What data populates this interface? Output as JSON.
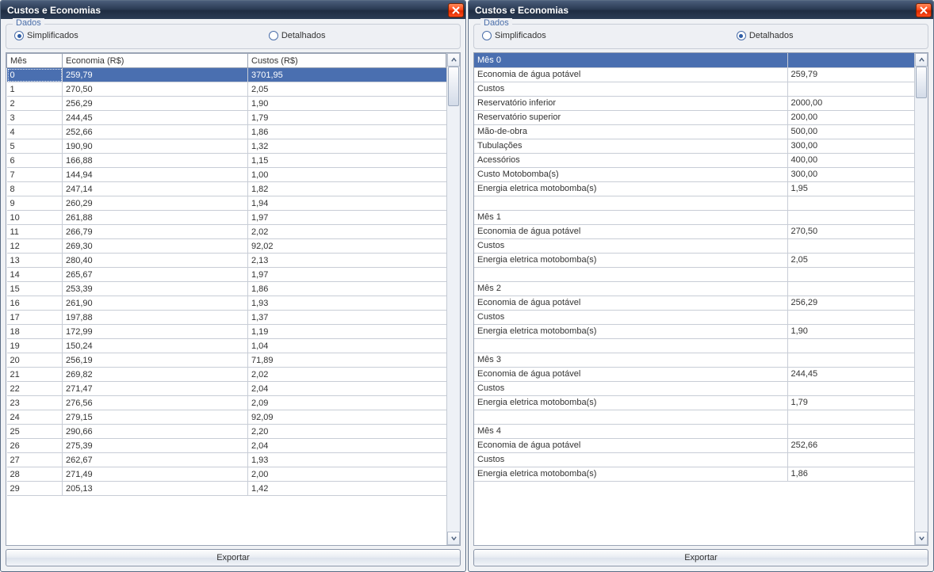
{
  "title": "Custos e Economias",
  "group_label": "Dados",
  "radio_simplificados": "Simplificados",
  "radio_detalhados": "Detalhados",
  "export_label": "Exportar",
  "simp_headers": {
    "mes": "Mês",
    "economia": "Economia (R$)",
    "custos": "Custos (R$)"
  },
  "simp_rows": [
    {
      "mes": "0",
      "economia": "259,79",
      "custos": "3701,95"
    },
    {
      "mes": "1",
      "economia": "270,50",
      "custos": "2,05"
    },
    {
      "mes": "2",
      "economia": "256,29",
      "custos": "1,90"
    },
    {
      "mes": "3",
      "economia": "244,45",
      "custos": "1,79"
    },
    {
      "mes": "4",
      "economia": "252,66",
      "custos": "1,86"
    },
    {
      "mes": "5",
      "economia": "190,90",
      "custos": "1,32"
    },
    {
      "mes": "6",
      "economia": "166,88",
      "custos": "1,15"
    },
    {
      "mes": "7",
      "economia": "144,94",
      "custos": "1,00"
    },
    {
      "mes": "8",
      "economia": "247,14",
      "custos": "1,82"
    },
    {
      "mes": "9",
      "economia": "260,29",
      "custos": "1,94"
    },
    {
      "mes": "10",
      "economia": "261,88",
      "custos": "1,97"
    },
    {
      "mes": "11",
      "economia": "266,79",
      "custos": "2,02"
    },
    {
      "mes": "12",
      "economia": "269,30",
      "custos": "92,02"
    },
    {
      "mes": "13",
      "economia": "280,40",
      "custos": "2,13"
    },
    {
      "mes": "14",
      "economia": "265,67",
      "custos": "1,97"
    },
    {
      "mes": "15",
      "economia": "253,39",
      "custos": "1,86"
    },
    {
      "mes": "16",
      "economia": "261,90",
      "custos": "1,93"
    },
    {
      "mes": "17",
      "economia": "197,88",
      "custos": "1,37"
    },
    {
      "mes": "18",
      "economia": "172,99",
      "custos": "1,19"
    },
    {
      "mes": "19",
      "economia": "150,24",
      "custos": "1,04"
    },
    {
      "mes": "20",
      "economia": "256,19",
      "custos": "71,89"
    },
    {
      "mes": "21",
      "economia": "269,82",
      "custos": "2,02"
    },
    {
      "mes": "22",
      "economia": "271,47",
      "custos": "2,04"
    },
    {
      "mes": "23",
      "economia": "276,56",
      "custos": "2,09"
    },
    {
      "mes": "24",
      "economia": "279,15",
      "custos": "92,09"
    },
    {
      "mes": "25",
      "economia": "290,66",
      "custos": "2,20"
    },
    {
      "mes": "26",
      "economia": "275,39",
      "custos": "2,04"
    },
    {
      "mes": "27",
      "economia": "262,67",
      "custos": "1,93"
    },
    {
      "mes": "28",
      "economia": "271,49",
      "custos": "2,00"
    },
    {
      "mes": "29",
      "economia": "205,13",
      "custos": "1,42"
    }
  ],
  "det_rows": [
    {
      "label": "Mês 0",
      "value": "",
      "selected": true
    },
    {
      "label": "Economia de água potável",
      "value": "259,79"
    },
    {
      "label": "Custos",
      "value": ""
    },
    {
      "label": "Reservatório inferior",
      "value": "2000,00"
    },
    {
      "label": "Reservatório superior",
      "value": "200,00"
    },
    {
      "label": "Mão-de-obra",
      "value": "500,00"
    },
    {
      "label": "Tubulações",
      "value": "300,00"
    },
    {
      "label": "Acessórios",
      "value": "400,00"
    },
    {
      "label": "Custo Motobomba(s)",
      "value": "300,00"
    },
    {
      "label": "Energia eletrica motobomba(s)",
      "value": "1,95"
    },
    {
      "label": "",
      "value": ""
    },
    {
      "label": "Mês 1",
      "value": ""
    },
    {
      "label": "Economia de água potável",
      "value": "270,50"
    },
    {
      "label": "Custos",
      "value": ""
    },
    {
      "label": "Energia eletrica motobomba(s)",
      "value": "2,05"
    },
    {
      "label": "",
      "value": ""
    },
    {
      "label": "Mês 2",
      "value": ""
    },
    {
      "label": "Economia de água potável",
      "value": "256,29"
    },
    {
      "label": "Custos",
      "value": ""
    },
    {
      "label": "Energia eletrica motobomba(s)",
      "value": "1,90"
    },
    {
      "label": "",
      "value": ""
    },
    {
      "label": "Mês 3",
      "value": ""
    },
    {
      "label": "Economia de água potável",
      "value": "244,45"
    },
    {
      "label": "Custos",
      "value": ""
    },
    {
      "label": "Energia eletrica motobomba(s)",
      "value": "1,79"
    },
    {
      "label": "",
      "value": ""
    },
    {
      "label": "Mês 4",
      "value": ""
    },
    {
      "label": "Economia de água potável",
      "value": "252,66"
    },
    {
      "label": "Custos",
      "value": ""
    },
    {
      "label": "Energia eletrica motobomba(s)",
      "value": "1,86"
    }
  ]
}
